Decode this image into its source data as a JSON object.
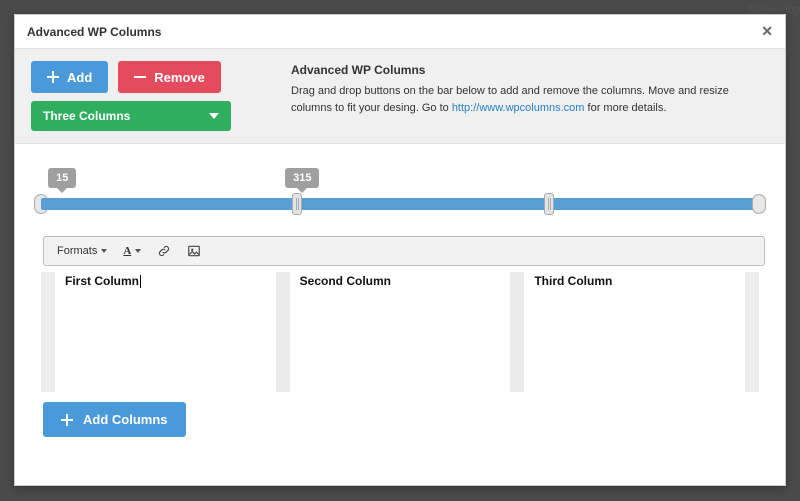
{
  "background": {
    "screen_options_label": "Screen Op"
  },
  "dialog": {
    "title": "Advanced WP Columns",
    "close_label": "✕"
  },
  "toolbar": {
    "add_label": "Add",
    "remove_label": "Remove",
    "preset_label": "Three Columns"
  },
  "intro": {
    "heading": "Advanced WP Columns",
    "text_before_link": "Drag and drop buttons on the bar below to add and remove the columns. Move and resize columns to fit your desing. Go to ",
    "link_text": "http://www.wpcolumns.com",
    "text_after_link": " for more details."
  },
  "slider": {
    "markers": [
      {
        "value": "15",
        "left_pct": 1
      },
      {
        "value": "315",
        "left_pct": 34
      }
    ],
    "handles_pct": [
      35,
      70
    ]
  },
  "editor_toolbar": {
    "formats_label": "Formats",
    "icons": [
      "text-color-icon",
      "link-icon",
      "image-icon"
    ]
  },
  "columns": [
    {
      "label": "First Column",
      "has_caret": true
    },
    {
      "label": "Second Column",
      "has_caret": false
    },
    {
      "label": "Third Column",
      "has_caret": false
    }
  ],
  "footer": {
    "add_columns_label": "Add Columns"
  }
}
